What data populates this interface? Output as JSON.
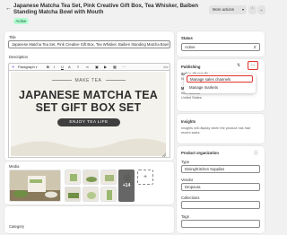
{
  "header": {
    "title": "Japanese Matcha Tea Set, Pink Creative Gift Box, Tea Whisker, Baiben Standing Matcha Bowl with Mouth",
    "status_badge": "Active",
    "more_actions": "More actions",
    "back_icon": "arrow-left-icon",
    "prev_icon": "chevron-up-icon",
    "next_icon": "chevron-down-icon"
  },
  "product": {
    "title_label": "Title",
    "title_value": "Japanese Matcha Tea Set, Pink Creative Gift Box, Tea Whisker, Baiben Standing Matcha Bowl with Mouth",
    "description_label": "Description",
    "toolbar": {
      "magic_icon": "sparkle-icon",
      "format_select": "Paragraph",
      "buttons": [
        "B",
        "I",
        "U",
        "A"
      ]
    }
  },
  "banner": {
    "small_title": "MAKE TEA",
    "main_title_line1": "JAPANESE MATCHA TEA",
    "main_title_line2": "SET GIFT BOX SET",
    "pill_text": "ENJOY TEA LIFE"
  },
  "media": {
    "label": "Media",
    "more_count": "+14",
    "add_icon": "plus-icon"
  },
  "category": {
    "label": "Category"
  },
  "status": {
    "label": "Status",
    "value": "Active"
  },
  "publishing": {
    "label": "Publishing",
    "sales_channels_label": "Sales channels",
    "sales_channels_note": "Not included in",
    "markets_label": "Markets",
    "markets_lines": [
      "International",
      "United States"
    ],
    "menu": {
      "button_icon": "more-horizontal-icon",
      "items": [
        "Manage sales channels",
        "Manage markets"
      ]
    }
  },
  "insights": {
    "label": "Insights",
    "text": "Insights will display when the product has had recent sales"
  },
  "organization": {
    "label": "Product organization",
    "type_label": "Type",
    "type_value": "Dining/Kitchen Supplies",
    "vendor_label": "Vendor",
    "vendor_value": "Dropoura",
    "collections_label": "Collections",
    "tags_label": "Tags"
  },
  "colors": {
    "accent_red": "#e0342c",
    "badge_bg": "#b4fed2",
    "badge_text": "#0c5132",
    "background": "#f1f1f1"
  }
}
